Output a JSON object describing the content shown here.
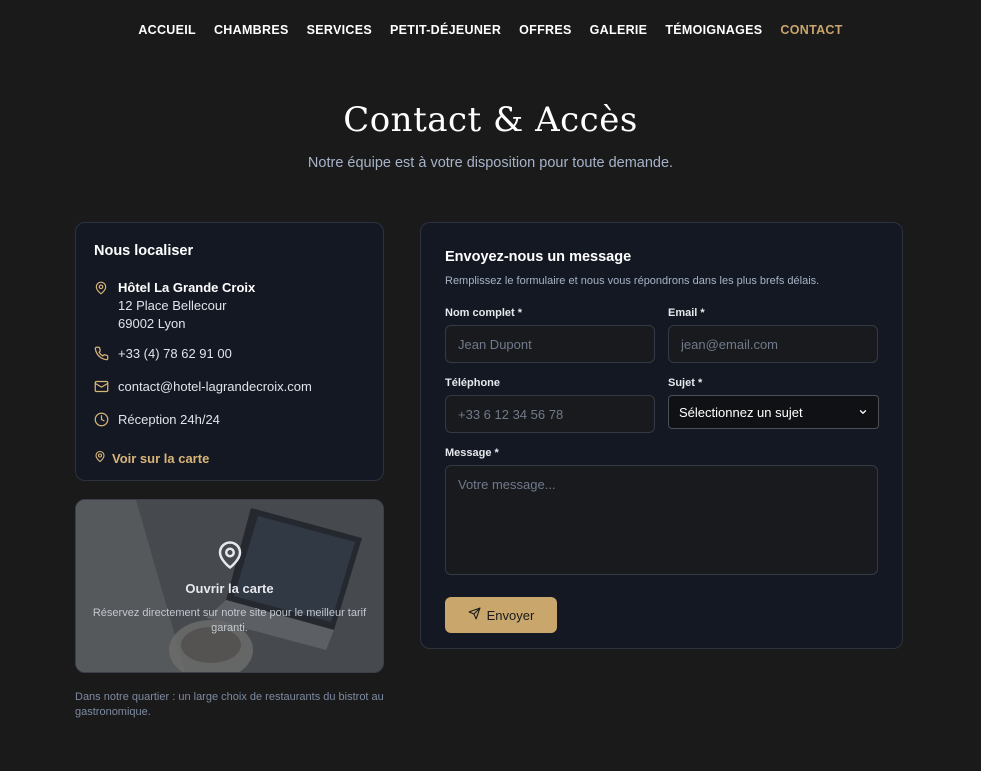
{
  "nav": {
    "items": [
      {
        "label": "ACCUEIL"
      },
      {
        "label": "CHAMBRES"
      },
      {
        "label": "SERVICES"
      },
      {
        "label": "PETIT-DÉJEUNER"
      },
      {
        "label": "OFFRES"
      },
      {
        "label": "GALERIE"
      },
      {
        "label": "TÉMOIGNAGES"
      },
      {
        "label": "CONTACT",
        "active": true
      }
    ]
  },
  "header": {
    "title": "Contact & Accès",
    "subtitle": "Notre équipe est à votre disposition pour toute demande."
  },
  "location": {
    "heading": "Nous localiser",
    "hotel_name": "Hôtel La Grande Croix",
    "address_line1": "12 Place Bellecour",
    "address_line2": "69002 Lyon",
    "phone": "+33 (4) 78 62 91 00",
    "email": "contact@hotel-lagrandecroix.com",
    "reception": "Réception 24h/24",
    "map_link": "Voir sur la carte"
  },
  "map_card": {
    "open_label": "Ouvrir la carte",
    "description": "Réservez directement sur notre site pour le meilleur tarif garanti."
  },
  "neighborhood_note": "Dans notre quartier : un large choix de restaurants du bistrot au gastronomique.",
  "form": {
    "heading": "Envoyez-nous un message",
    "intro": "Remplissez le formulaire et nous vous répondrons dans les plus brefs délais.",
    "name_label": "Nom complet *",
    "name_placeholder": "Jean Dupont",
    "email_label": "Email *",
    "email_placeholder": "jean@email.com",
    "phone_label": "Téléphone",
    "phone_placeholder": "+33 6 12 34 56 78",
    "subject_label": "Sujet *",
    "subject_value": "Sélectionnez un sujet",
    "message_label": "Message *",
    "message_placeholder": "Votre message...",
    "submit_label": "Envoyer"
  },
  "colors": {
    "background": "#1a1a1b",
    "card": "#131822",
    "accent": "#c9a66b",
    "link": "#d9b47a"
  }
}
